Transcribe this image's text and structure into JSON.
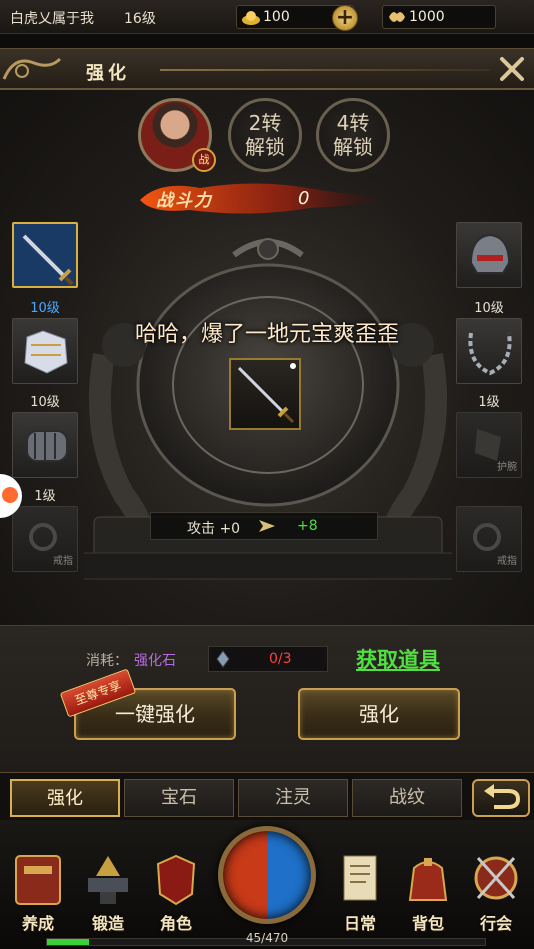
{
  "topbar": {
    "player_name": "白虎乂属于我",
    "player_level": "16级",
    "gold": "100",
    "jade": "1000",
    "plus": "+"
  },
  "panel": {
    "title": "强化",
    "unlock_2": [
      "2转",
      "解锁"
    ],
    "unlock_4": [
      "4转",
      "解锁"
    ],
    "badge": "战",
    "power_label": "战斗力",
    "power_value": "0",
    "message": "哈哈，爆了一地元宝爽歪歪"
  },
  "left_slots": [
    {
      "name": "weapon",
      "level": "10级",
      "selected": true
    },
    {
      "name": "armor",
      "level": "10级"
    },
    {
      "name": "bracer-left",
      "level": "1级"
    },
    {
      "name": "ring-left",
      "tag": "戒指",
      "empty": true
    }
  ],
  "right_slots": [
    {
      "name": "helmet",
      "level": "10级"
    },
    {
      "name": "necklace",
      "level": "1级"
    },
    {
      "name": "bracer-right",
      "tag": "护腕",
      "empty": true
    },
    {
      "name": "ring-right",
      "tag": "戒指",
      "empty": true
    }
  ],
  "stat": {
    "label": "攻击 +0",
    "bonus": "+8"
  },
  "cost": {
    "label": "消耗：",
    "item": "强化石",
    "count": "0/3",
    "get_link": "获取道具"
  },
  "buttons": {
    "one_key": "一键强化",
    "strengthen": "强化",
    "vip_tag": "至尊专享"
  },
  "tabs": [
    {
      "label": "强化",
      "active": true
    },
    {
      "label": "宝石"
    },
    {
      "label": "注灵"
    },
    {
      "label": "战纹"
    }
  ],
  "nav": [
    {
      "label": "养成",
      "icon": "book-icon"
    },
    {
      "label": "锻造",
      "icon": "anvil-icon"
    },
    {
      "label": "角色",
      "icon": "armor-icon"
    },
    {
      "label": "日常",
      "icon": "scroll-icon"
    },
    {
      "label": "背包",
      "icon": "bag-icon"
    },
    {
      "label": "行会",
      "icon": "shield-icon"
    }
  ],
  "exp": {
    "text": "45/470",
    "fraction": 0.0957
  },
  "colors": {
    "accent_gold": "#c8a050",
    "selected_blue": "#1a3a66",
    "level_blue": "#4aa8ff",
    "green": "#50e040",
    "red_count": "#ff4040"
  }
}
